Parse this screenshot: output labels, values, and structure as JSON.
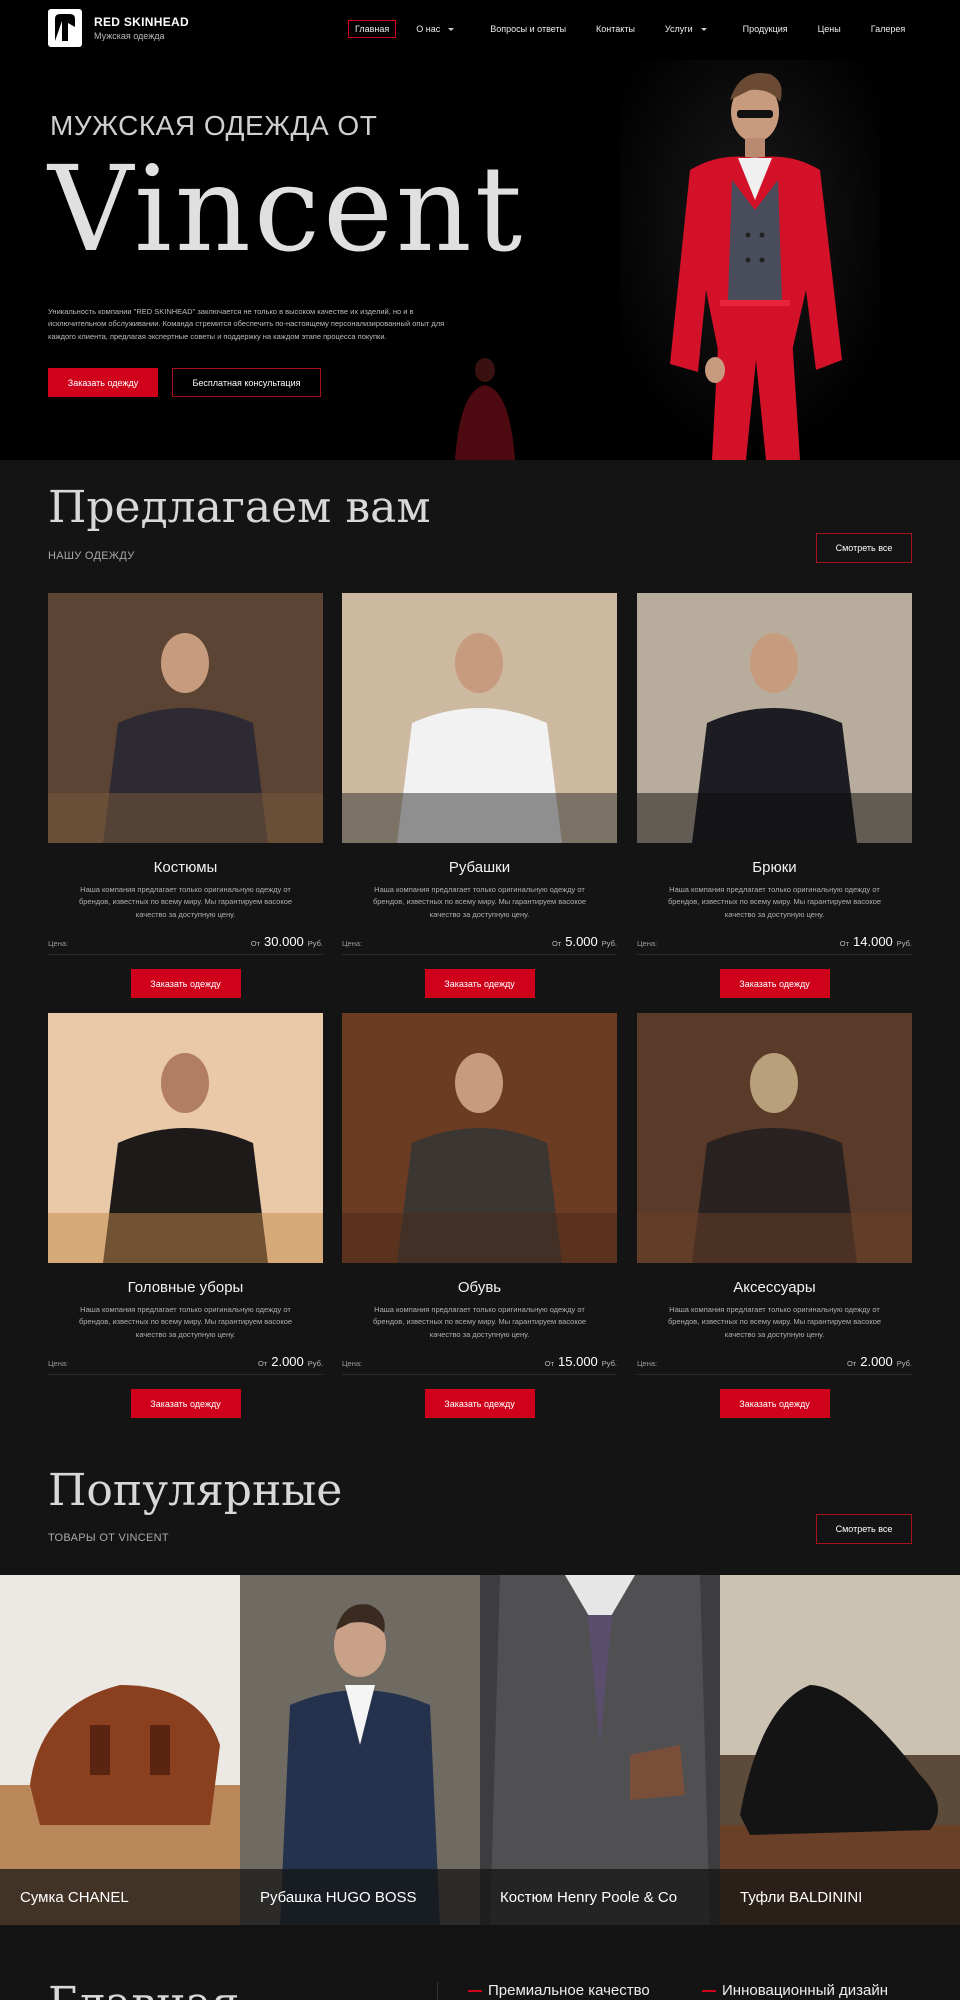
{
  "header": {
    "logo_title": "RED SKINHEAD",
    "logo_sub": "Мужская одежда",
    "nav": [
      {
        "label": "Главная",
        "active": true,
        "dropdown": false
      },
      {
        "label": "О нас",
        "active": false,
        "dropdown": true
      },
      {
        "label": "Вопросы и ответы",
        "active": false,
        "dropdown": false
      },
      {
        "label": "Контакты",
        "active": false,
        "dropdown": false
      },
      {
        "label": "Услуги",
        "active": false,
        "dropdown": true
      },
      {
        "label": "Продукция",
        "active": false,
        "dropdown": false
      },
      {
        "label": "Цены",
        "active": false,
        "dropdown": false
      },
      {
        "label": "Галерея",
        "active": false,
        "dropdown": false
      }
    ]
  },
  "hero": {
    "pre_title": "МУЖСКАЯ ОДЕЖДА ОТ",
    "title": "Vincent",
    "description": "Уникальность компании \"RED SKINHEAD\" заключается не только в высоком качестве их изделий, но и в исключительном обслуживании. Команда стремится обеспечить по-настоящему персонализированный опыт для каждого клиента, предлагая экспертные советы и поддержку на каждом этапе процесса покупки.",
    "primary_button": "Заказать одежду",
    "secondary_button": "Бесплатная консультация"
  },
  "offer": {
    "title": "Предлагаем вам",
    "subtitle": "НАШУ ОДЕЖДУ",
    "see_all": "Смотреть все",
    "price_label": "Цена:",
    "price_prefix": "От",
    "currency": "Руб.",
    "button": "Заказать одежду",
    "items": [
      {
        "name": "Костюмы",
        "desc": "Наша компания предлагает только оригинальную одежду от брендов, известных по всему миру. Мы гарантируем васокое качество за доступную цену.",
        "price": "30.000",
        "image": "suit-man-photo"
      },
      {
        "name": "Рубашки",
        "desc": "Наша компания предлагает только оригинальную одежду от брендов, известных по всему миру. Мы гарантируем васокое качество за доступную цену.",
        "price": "5.000",
        "image": "scooter-man-photo"
      },
      {
        "name": "Брюки",
        "desc": "Наша компания предлагает только оригинальную одежду от брендов, известных по всему миру. Мы гарантируем васокое качество за доступную цену.",
        "price": "14.000",
        "image": "man-car-photo"
      },
      {
        "name": "Головные уборы",
        "desc": "Наша компания предлагает только оригинальную одежду от брендов, известных по всему миру. Мы гарантируем васокое качество за доступную цену.",
        "price": "2.000",
        "image": "hat-man-photo"
      },
      {
        "name": "Обувь",
        "desc": "Наша компания предлагает только оригинальную одежду от брендов, известных по всему миру. Мы гарантируем васокое качество за доступную цену.",
        "price": "15.000",
        "image": "shoes-photo"
      },
      {
        "name": "Аксессуары",
        "desc": "Наша компания предлагает только оригинальную одежду от брендов, известных по всему миру. Мы гарантируем васокое качество за доступную цену.",
        "price": "2.000",
        "image": "watch-box-photo"
      }
    ]
  },
  "popular": {
    "title": "Популярные",
    "subtitle": "ТОВАРЫ ОТ VINCENT",
    "see_all": "Смотреть все",
    "items": [
      {
        "label": "Сумка CHANEL",
        "image": "leather-bag-photo"
      },
      {
        "label": "Рубашка HUGO BOSS",
        "image": "plaid-suit-photo"
      },
      {
        "label": "Костюм Henry Poole & Co",
        "image": "suit-tie-photo"
      },
      {
        "label": "Туфли BALDININI",
        "image": "black-shoes-photo"
      }
    ]
  },
  "bottom": {
    "title": "Главная",
    "features": [
      "Премиальное качество",
      "Инновационный дизайн"
    ]
  },
  "colors": {
    "accent": "#d0021b",
    "background": "#141414",
    "hero_bg": "#000000"
  }
}
